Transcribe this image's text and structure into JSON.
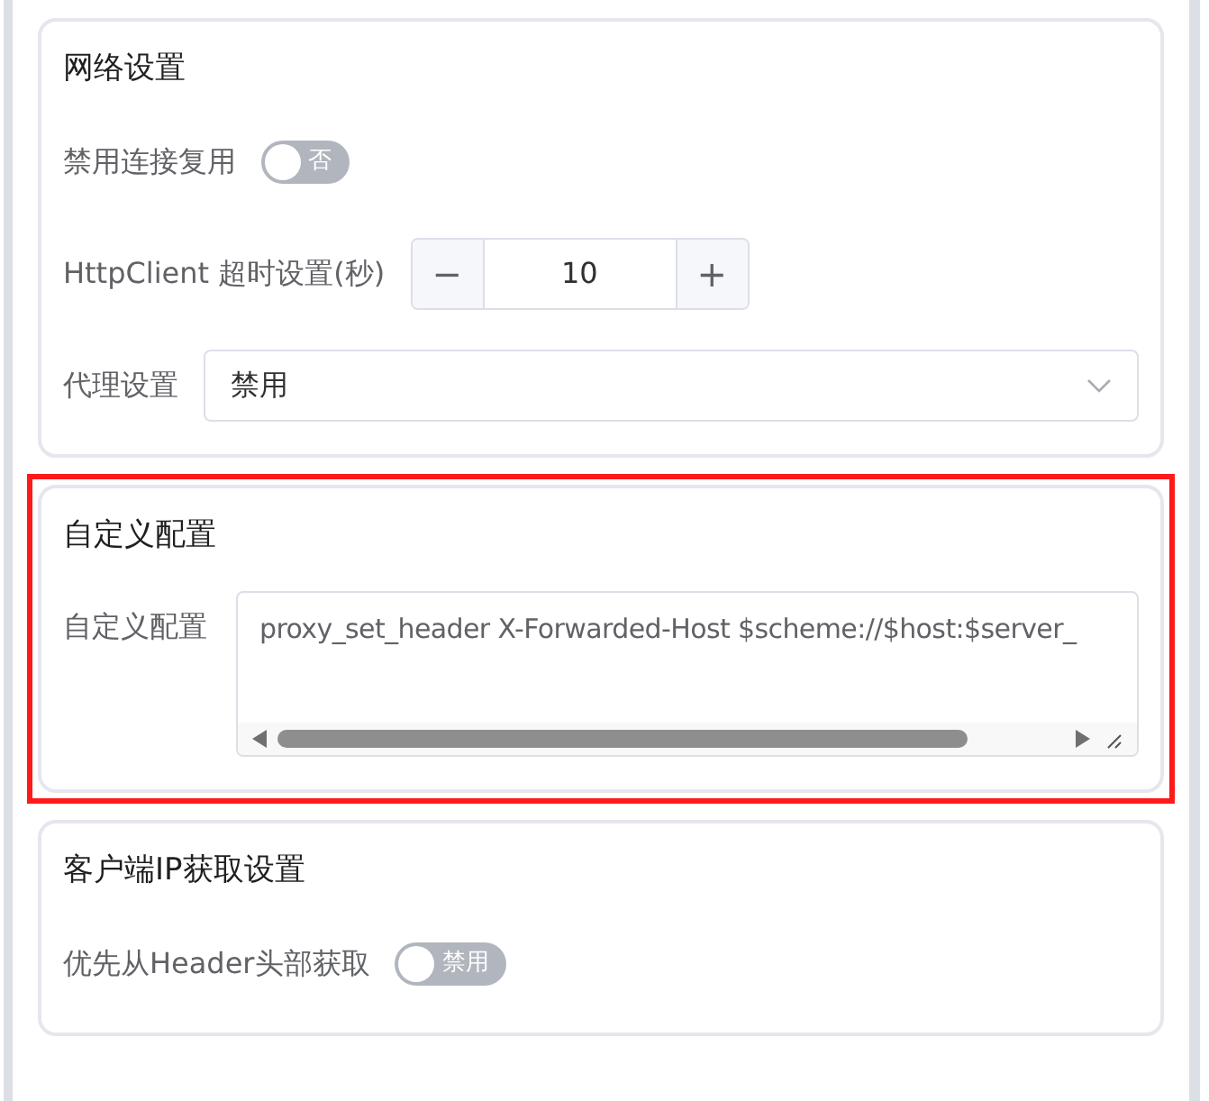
{
  "sections": [
    {
      "title": "网络设置",
      "highlighted": false,
      "fields": [
        {
          "kind": "switch",
          "label": "禁用连接复用",
          "on": false,
          "switch_text": "否"
        },
        {
          "kind": "stepper",
          "label": "HttpClient 超时设置(秒)",
          "value": "10",
          "minus": "−",
          "plus": "+"
        },
        {
          "kind": "select",
          "label": "代理设置",
          "value": "禁用"
        }
      ]
    },
    {
      "title": "自定义配置",
      "highlighted": true,
      "fields": [
        {
          "kind": "textarea",
          "label": "自定义配置",
          "value": "proxy_set_header X-Forwarded-Host $scheme://$host:$server_"
        }
      ]
    },
    {
      "title": "客户端IP获取设置",
      "highlighted": false,
      "fields": [
        {
          "kind": "switch",
          "label": "优先从Header头部获取",
          "on": false,
          "switch_text": "禁用"
        }
      ]
    }
  ]
}
